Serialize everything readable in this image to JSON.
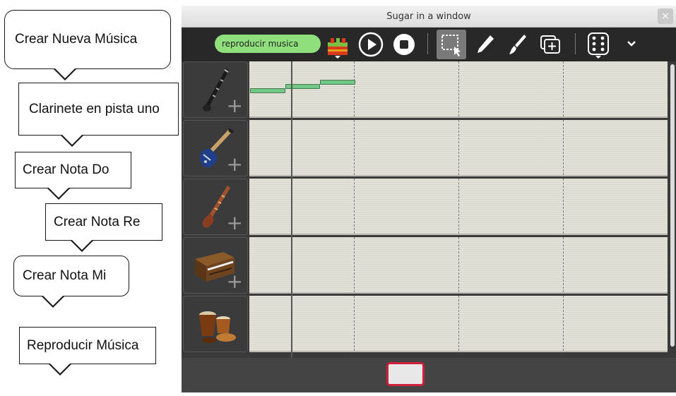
{
  "callouts": [
    {
      "id": "crear-nueva-musica",
      "text": "Crear Nueva Música"
    },
    {
      "id": "clarinete",
      "text": "Clarinete en pista uno"
    },
    {
      "id": "nota-do",
      "text": "Crear Nota Do"
    },
    {
      "id": "nota-re",
      "text": "Crear Nota Re"
    },
    {
      "id": "nota-mi",
      "text": "Crear Nota Mi"
    },
    {
      "id": "reproducir",
      "text": "Reproducir Música"
    }
  ],
  "window": {
    "title": "Sugar in a window",
    "close_glyph": "×"
  },
  "toolbar": {
    "play_input_value": "reproducir musica",
    "icons": [
      "lego-brick-icon",
      "play-icon",
      "stop-icon",
      "select-icon",
      "pencil-icon",
      "brush-icon",
      "duplicate-icon",
      "dice-icon",
      "chevron-down-icon"
    ]
  },
  "tracks": [
    {
      "instrument": "clarinet",
      "icon": "clarinet-icon",
      "has_plus": true
    },
    {
      "instrument": "electric bass",
      "icon": "bass-guitar-icon",
      "has_plus": true
    },
    {
      "instrument": "shehnai",
      "icon": "shehnai-icon",
      "has_plus": true
    },
    {
      "instrument": "harmonium",
      "icon": "harmonium-icon",
      "has_plus": true
    },
    {
      "instrument": "drums",
      "icon": "drums-icon",
      "has_plus": false
    }
  ],
  "colors": {
    "play_field": "#8fe07d",
    "note_green": "#73c786",
    "bottom_tab_border": "#d21e3a",
    "toolbar": "#282828"
  }
}
